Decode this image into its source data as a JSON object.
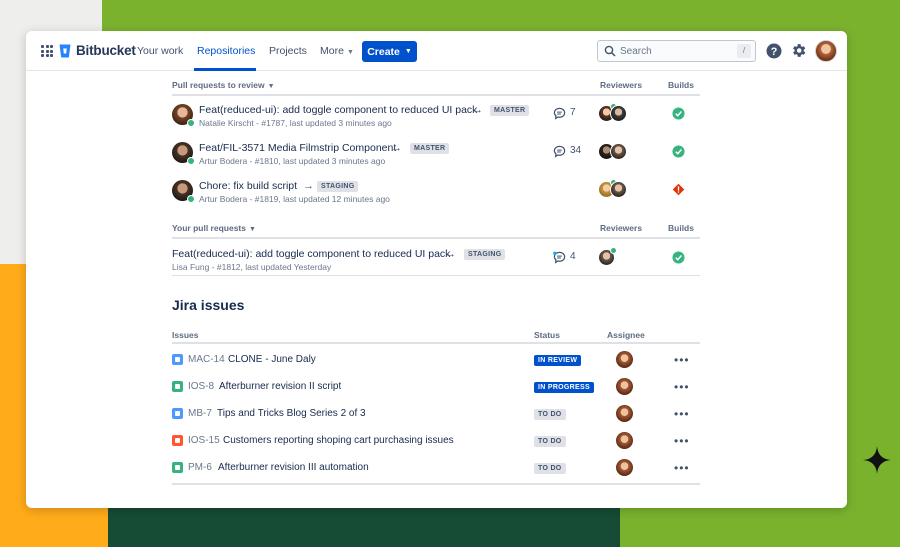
{
  "app": {
    "name": "Bitbucket"
  },
  "nav": {
    "items": [
      {
        "label": "Your work"
      },
      {
        "label": "Repositories"
      },
      {
        "label": "Projects"
      },
      {
        "label": "More"
      }
    ],
    "active": "Repositories",
    "create_label": "Create",
    "search_placeholder": "Search",
    "search_shortcut": "/"
  },
  "sections": {
    "review": {
      "title": "Pull requests to review",
      "reviewers_header": "Reviewers",
      "builds_header": "Builds"
    },
    "yours": {
      "title": "Your pull requests",
      "reviewers_header": "Reviewers",
      "builds_header": "Builds"
    }
  },
  "pull_requests_to_review": [
    {
      "title": "Feat(reduced-ui): add toggle component to reduced UI pack",
      "branch": "MASTER",
      "meta": "Natalie Kirscht - #1787, last updated  3 minutes ago",
      "comments": "7",
      "build": "passed"
    },
    {
      "title": "Feat/FIL-3571 Media Filmstrip Component",
      "branch": "MASTER",
      "meta": "Artur Bodera - #1810, last updated 3 minutes ago",
      "comments": "34",
      "build": "passed"
    },
    {
      "title": "Chore: fix build script",
      "branch": "STAGING",
      "meta": "Artur Bodera - #1819, last updated  12 minutes ago",
      "comments": "",
      "build": "failed"
    }
  ],
  "your_pull_requests": [
    {
      "title": "Feat(reduced-ui): add toggle component to reduced UI pack",
      "branch": "STAGING",
      "meta": "Lisa Fung - #1812, last updated Yesterday",
      "comments": "4",
      "build": "passed"
    }
  ],
  "jira": {
    "title": "Jira issues",
    "headers": {
      "issues": "Issues",
      "status": "Status",
      "assignee": "Assignee"
    },
    "issues": [
      {
        "key": "MAC-14",
        "summary": "CLONE - June Daly",
        "status": "IN REVIEW",
        "type": "task",
        "type_color": "#4c9aff"
      },
      {
        "key": "IOS-8",
        "summary": "Afterburner revision II script",
        "status": "IN PROGRESS",
        "type": "story",
        "type_color": "#36b37e"
      },
      {
        "key": "MB-7",
        "summary": "Tips and Tricks Blog Series 2 of 3",
        "status": "TO DO",
        "type": "task",
        "type_color": "#4c9aff"
      },
      {
        "key": "IOS-15",
        "summary": "Customers reporting shoping cart purchasing issues",
        "status": "TO DO",
        "type": "bug",
        "type_color": "#ff5630"
      },
      {
        "key": "PM-6",
        "summary": "Afterburner revision III automation",
        "status": "TO DO",
        "type": "story",
        "type_color": "#36b37e"
      }
    ]
  },
  "colors": {
    "brand": "#0052cc",
    "success": "#36b37e",
    "danger": "#de350b",
    "background_green": "#7ab22e",
    "background_orange": "#ffab1a"
  }
}
